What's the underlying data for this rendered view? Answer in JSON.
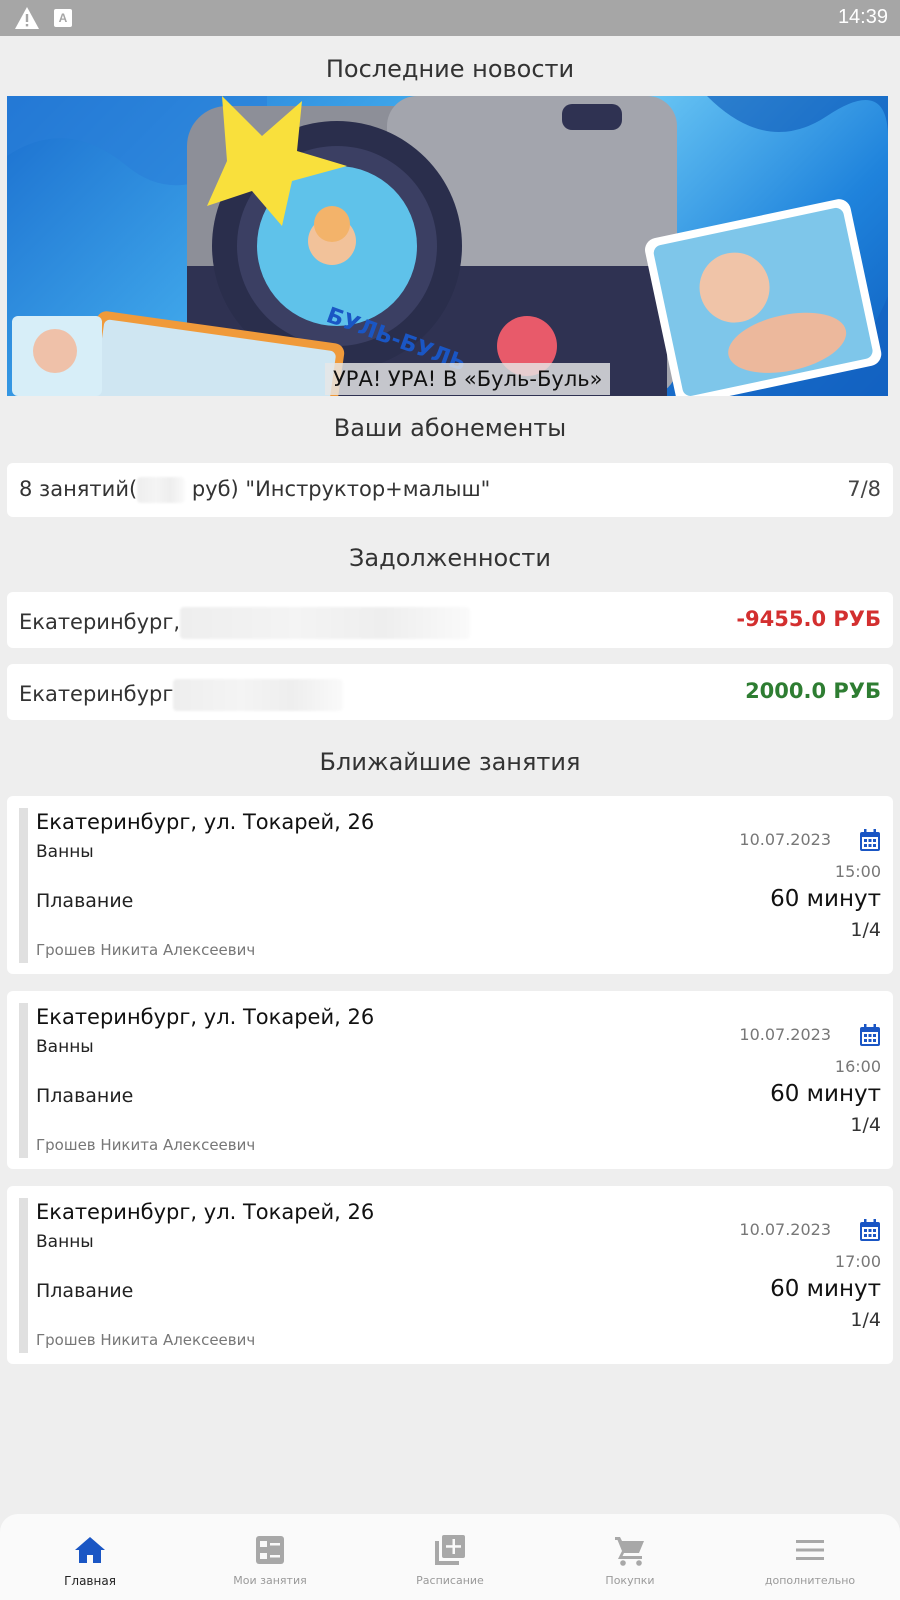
{
  "status_bar": {
    "time": "14:39"
  },
  "news": {
    "title": "Последние новости",
    "banner_caption": "УРА! УРА! В «Буль-Буль»",
    "logo_text": "БУЛЬ-БУЛЬ"
  },
  "subscriptions": {
    "title": "Ваши абонементы",
    "items": [
      {
        "label_prefix": "8 занятий(",
        "label_suffix": "руб)  \"Инструктор+малыш\"",
        "count": "7/8"
      }
    ]
  },
  "debts": {
    "title": "Задолженности",
    "items": [
      {
        "city": "Екатеринбург,",
        "amount": "-9455.0 РУБ",
        "color": "#d32f2f"
      },
      {
        "city": "Екатеринбург",
        "amount": "2000.0 РУБ",
        "color": "#2e7d32"
      }
    ]
  },
  "upcoming": {
    "title": "Ближайшие занятия",
    "items": [
      {
        "address": "Екатеринбург, ул. Токарей, 26",
        "room": "Ванны",
        "kind": "Плавание",
        "teacher": "Грошев Никита Алексеевич",
        "date": "10.07.2023",
        "time": "15:00",
        "duration": "60 минут",
        "count": "1/4"
      },
      {
        "address": "Екатеринбург, ул. Токарей, 26",
        "room": "Ванны",
        "kind": "Плавание",
        "teacher": "Грошев Никита Алексеевич",
        "date": "10.07.2023",
        "time": "16:00",
        "duration": "60 минут",
        "count": "1/4"
      },
      {
        "address": "Екатеринбург, ул. Токарей, 26",
        "room": "Ванны",
        "kind": "Плавание",
        "teacher": "Грошев Никита Алексеевич",
        "date": "10.07.2023",
        "time": "17:00",
        "duration": "60 минут",
        "count": "1/4"
      }
    ]
  },
  "nav": {
    "items": [
      {
        "label": "Главная",
        "icon": "home-icon"
      },
      {
        "label": "Мои занятия",
        "icon": "dashboard-icon"
      },
      {
        "label": "Расписание",
        "icon": "library-add-icon"
      },
      {
        "label": "Покупки",
        "icon": "cart-icon"
      },
      {
        "label": "дополнительно",
        "icon": "menu-icon"
      }
    ]
  },
  "colors": {
    "accent": "#1a56c4",
    "debt_negative": "#d32f2f",
    "debt_positive": "#2e7d32"
  }
}
